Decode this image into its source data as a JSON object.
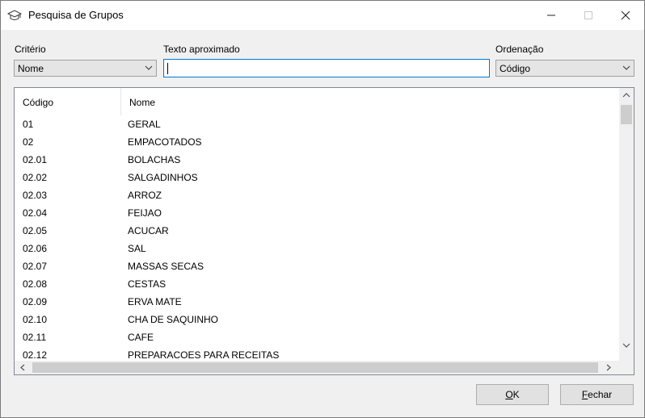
{
  "window": {
    "title": "Pesquisa de Grupos",
    "controls": {
      "minimize": "—",
      "maximize": "☐",
      "close": "✕"
    }
  },
  "filters": {
    "criterio_label": "Critério",
    "criterio_value": "Nome",
    "texto_label": "Texto aproximado",
    "texto_value": "",
    "ordenacao_label": "Ordenação",
    "ordenacao_value": "Código"
  },
  "grid": {
    "columns": [
      "Código",
      "Nome"
    ],
    "rows": [
      {
        "code": "01",
        "name": "GERAL"
      },
      {
        "code": "02",
        "name": "EMPACOTADOS"
      },
      {
        "code": "02.01",
        "name": "BOLACHAS"
      },
      {
        "code": "02.02",
        "name": "SALGADINHOS"
      },
      {
        "code": "02.03",
        "name": "ARROZ"
      },
      {
        "code": "02.04",
        "name": "FEIJAO"
      },
      {
        "code": "02.05",
        "name": "ACUCAR"
      },
      {
        "code": "02.06",
        "name": "SAL"
      },
      {
        "code": "02.07",
        "name": "MASSAS SECAS"
      },
      {
        "code": "02.08",
        "name": "CESTAS"
      },
      {
        "code": "02.09",
        "name": "ERVA MATE"
      },
      {
        "code": "02.10",
        "name": "CHA DE SAQUINHO"
      },
      {
        "code": "02.11",
        "name": "CAFE"
      },
      {
        "code": "02.12",
        "name": "PREPARACOES PARA RECEITAS"
      }
    ]
  },
  "buttons": {
    "ok_mnemonic": "O",
    "ok_rest": "K",
    "fechar_mnemonic": "F",
    "fechar_rest": "echar"
  },
  "icons": {
    "app": "graduation-cap-icon"
  }
}
